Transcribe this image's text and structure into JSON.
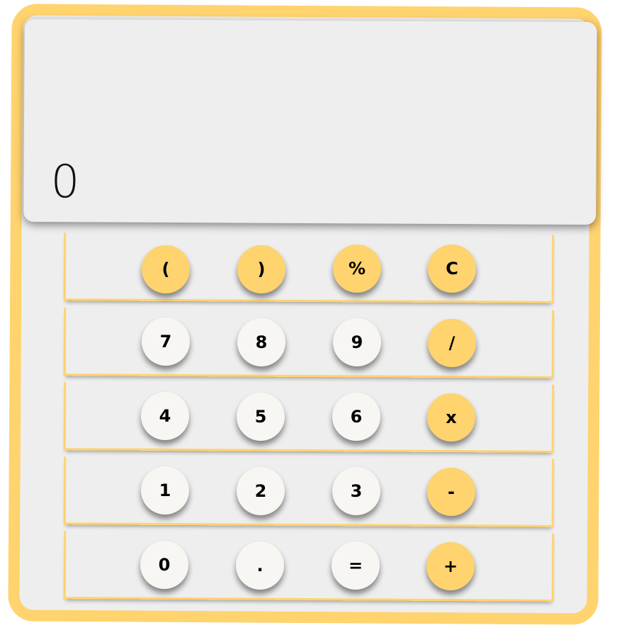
{
  "display": {
    "value": "0"
  },
  "keys": {
    "row1": [
      {
        "label": "(",
        "kind": "op"
      },
      {
        "label": ")",
        "kind": "op"
      },
      {
        "label": "%",
        "kind": "op"
      },
      {
        "label": "C",
        "kind": "op"
      }
    ],
    "row2": [
      {
        "label": "7",
        "kind": "num"
      },
      {
        "label": "8",
        "kind": "num"
      },
      {
        "label": "9",
        "kind": "num"
      },
      {
        "label": "/",
        "kind": "op"
      }
    ],
    "row3": [
      {
        "label": "4",
        "kind": "num"
      },
      {
        "label": "5",
        "kind": "num"
      },
      {
        "label": "6",
        "kind": "num"
      },
      {
        "label": "x",
        "kind": "op"
      }
    ],
    "row4": [
      {
        "label": "1",
        "kind": "num"
      },
      {
        "label": "2",
        "kind": "num"
      },
      {
        "label": "3",
        "kind": "num"
      },
      {
        "label": "-",
        "kind": "op"
      }
    ],
    "row5": [
      {
        "label": "0",
        "kind": "num"
      },
      {
        "label": ".",
        "kind": "num"
      },
      {
        "label": "=",
        "kind": "num"
      },
      {
        "label": "+",
        "kind": "op"
      }
    ]
  },
  "colors": {
    "frame": "#ffd36e",
    "operator_key": "#ffd36e",
    "number_key": "#f7f6f3",
    "body": "#eeeeee"
  }
}
